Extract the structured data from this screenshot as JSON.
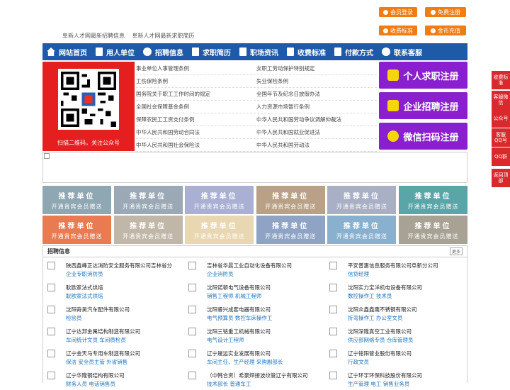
{
  "top": {
    "links": [
      "阜新人才网最新招聘信息",
      "阜新人才网最新求职简历"
    ],
    "buttons": [
      "会员登录",
      "免费注册",
      "收费标准",
      "金币充值"
    ]
  },
  "nav": [
    "网站首页",
    "用人单位",
    "招聘信息",
    "求职简历",
    "职场资讯",
    "收费标准",
    "付款方式",
    "联系客服"
  ],
  "qr": {
    "caption": "扫描二维码，关注公众号"
  },
  "laws": [
    [
      "事业单位人事管理条例",
      "女职工劳动保护特别规定"
    ],
    [
      "工伤保险条例",
      "失业保险条例"
    ],
    [
      "国务院关于职工工作时间的规定",
      "全国年节及纪念日放假办法"
    ],
    [
      "全国社会保障基金条例",
      "人力资源市场暂行条例"
    ],
    [
      "保障农民工工资支付条例",
      "中华人民共和国劳动争议调解仲裁法"
    ],
    [
      "中华人民共和国劳动合同法",
      "中华人民共和国就业促进法"
    ],
    [
      "中华人民共和国社会保险法",
      "中华人民共和国劳动法"
    ]
  ],
  "register": [
    "个人求职注册",
    "企业招聘注册",
    "微信扫码注册"
  ],
  "tiles": {
    "title": "推荐单位",
    "subtitle": "开通贵宾会员赠送",
    "colors": [
      "#8fa6b3",
      "#9aa9b5",
      "#a9b0d4",
      "#b8a186",
      "#a9b0c6",
      "#5aa5a8",
      "#e97b52",
      "#c0b7a8",
      "#e8d7b0",
      "#8fa4c4",
      "#8ab0d0",
      "#a8a294"
    ]
  },
  "jobs": {
    "title": "招聘信息",
    "more": "更多",
    "items": [
      {
        "company": "陕西鑫峰正达消防安全服务有限公司吉林省分",
        "positions": "企业专职消防员"
      },
      {
        "company": "吉林省华晨工业自动化设备有限公司",
        "positions": "企业消防员"
      },
      {
        "company": "平安普惠信息服务有限公司阜新分公司",
        "positions": "信贷经理"
      },
      {
        "company": "耿欧家法式烘焙",
        "positions": "耿欧家法式烘焙"
      },
      {
        "company": "沈阳诺顿电气设备有限公司",
        "positions": "销售工程师 机械工程师"
      },
      {
        "company": "沈阳实力宝洋机电设备有限公司",
        "positions": "数控操作工 技术员"
      },
      {
        "company": "沈阳奇昊汽车配件有限公司",
        "positions": "检验员"
      },
      {
        "company": "沈阳睿兴成套电器有限公司",
        "positions": "电气预算员 数控车床操作工"
      },
      {
        "company": "沈阳众鑫鑫鹰不锈钢有限公司",
        "positions": "折弯操作工 办公室文员"
      },
      {
        "company": "辽宁达邦金属结构制造有限公司",
        "positions": "车间统计文员 车间质检员"
      },
      {
        "company": "沈阳三铭重工机械有限公司",
        "positions": "电气设计工程师"
      },
      {
        "company": "沈阳深隆真空工业有限公司",
        "positions": "供应部网络专员 仓库管理员"
      },
      {
        "company": "辽宁金天马专用车制造有限公司",
        "positions": "保洁 安全员主管 外省销售"
      },
      {
        "company": "辽宁晟运实业发展有限公司",
        "positions": "车间主任、生产经理 采购副部长"
      },
      {
        "company": "辽宁铭阳管业股份有限公司",
        "positions": "行政文员"
      },
      {
        "company": "辽宁华隆钢结构有限公司",
        "positions": "财务人员 电话销售员"
      },
      {
        "company": "（中韩合资）希豪焊接波纹管辽宁有限公司",
        "positions": "技术部长 普通车工"
      },
      {
        "company": "辽宁环宇环保科技股份有限公司",
        "positions": "生产管理 电工 销售业务员"
      }
    ]
  },
  "side": [
    "收费标准",
    "客服微信",
    "公众号",
    "客服QQ号",
    "QQ群",
    "返回顶部"
  ]
}
